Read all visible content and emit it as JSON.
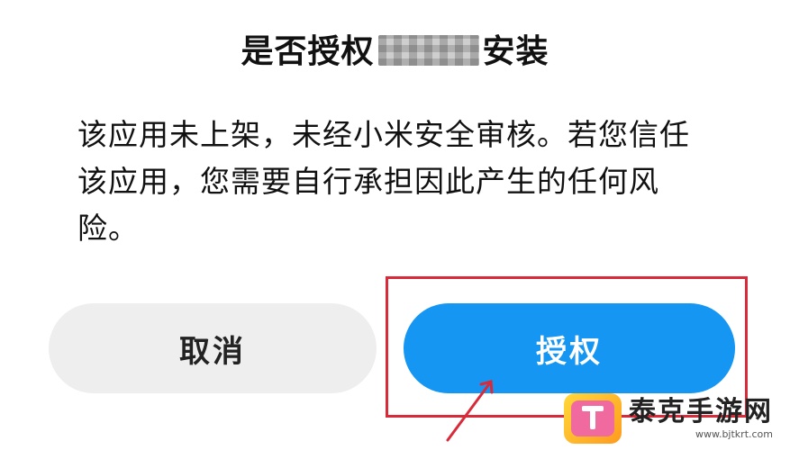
{
  "dialog": {
    "title_prefix": "是否授权",
    "title_suffix": "安装",
    "message": "该应用未上架，未经小米安全审核。若您信任该应用，您需要自行承担因此产生的任何风险。",
    "cancel_label": "取消",
    "authorize_label": "授权"
  },
  "colors": {
    "authorize_button": "#1596f2",
    "cancel_button": "#eeeeee",
    "highlight_box": "#d92a3a"
  },
  "watermark": {
    "name": "泰克手游网",
    "url": "www.bjtkrt.com",
    "logo_icon": "t-logo-icon"
  }
}
